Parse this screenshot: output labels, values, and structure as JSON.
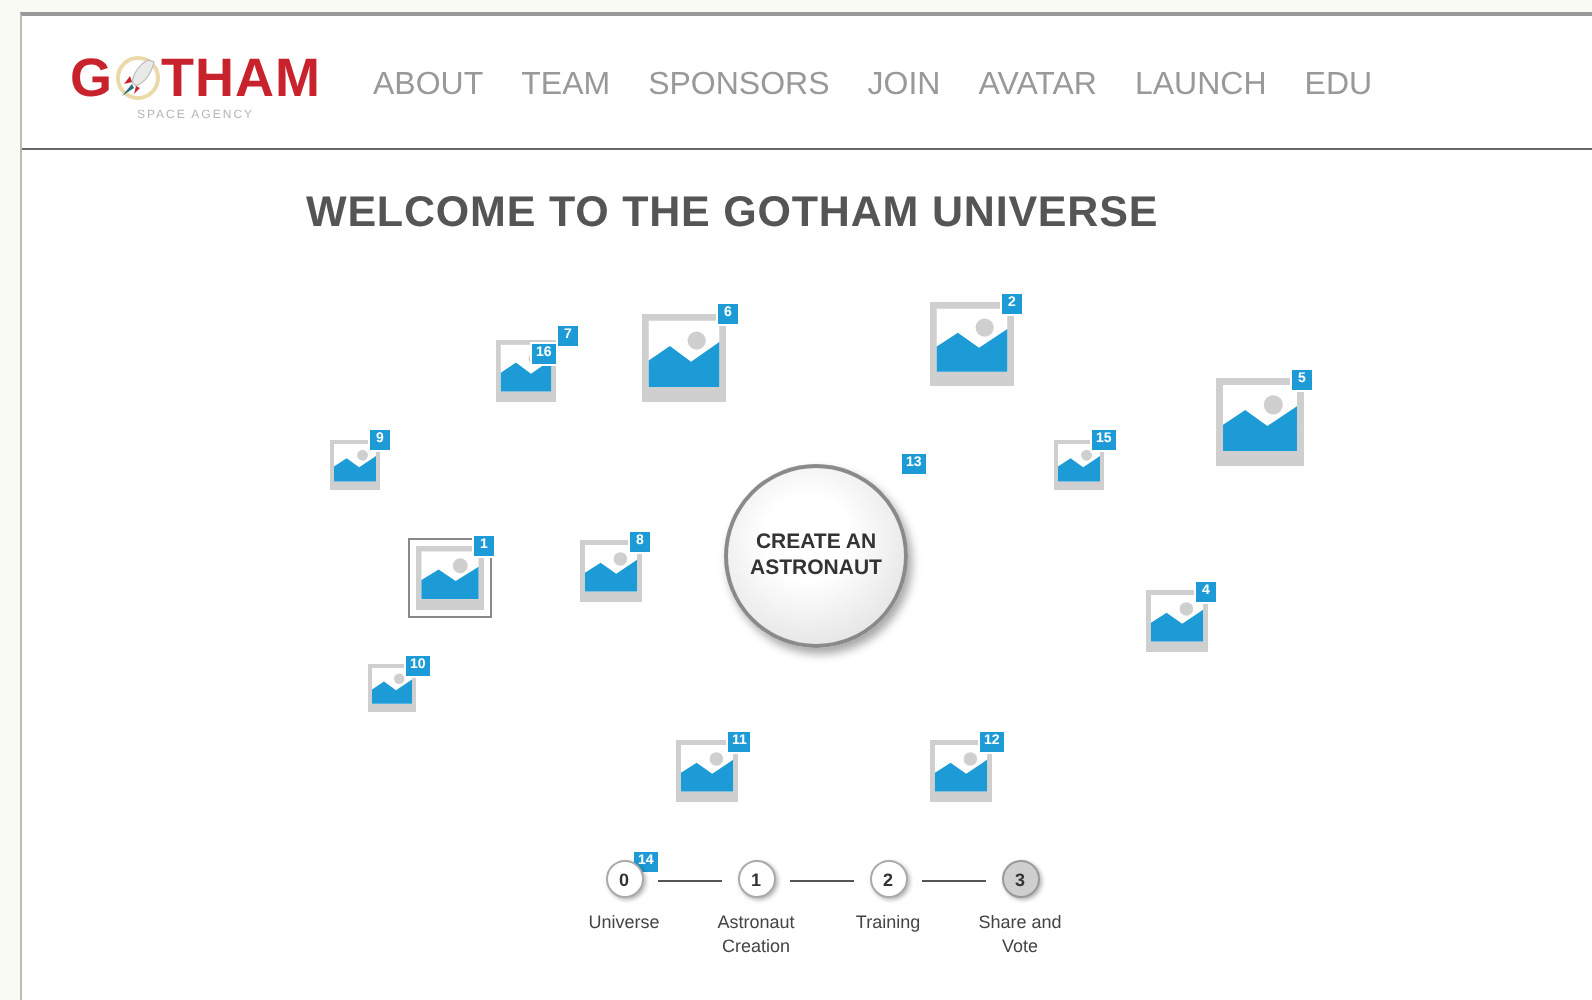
{
  "logo": {
    "before": "G",
    "after": "THAM",
    "tagline": "SPACE AGENCY"
  },
  "nav": [
    "ABOUT",
    "TEAM",
    "SPONSORS",
    "JOIN",
    "AVATAR",
    "LAUNCH",
    "EDU"
  ],
  "title": "WELCOME TO THE GOTHAM UNIVERSE",
  "items": [
    {
      "kind": "image",
      "badge": "6",
      "selected": false
    },
    {
      "kind": "image",
      "badge": "2",
      "selected": false
    },
    {
      "kind": "badge",
      "badge": "7"
    },
    {
      "kind": "image",
      "badge": "16",
      "selected": false
    },
    {
      "kind": "image",
      "badge": "5",
      "selected": false
    },
    {
      "kind": "image",
      "badge": "9",
      "selected": false
    },
    {
      "kind": "image",
      "badge": "15",
      "selected": false
    },
    {
      "kind": "badge",
      "badge": "13"
    },
    {
      "kind": "image",
      "badge": "1",
      "selected": true
    },
    {
      "kind": "image",
      "badge": "8",
      "selected": false
    },
    {
      "kind": "image",
      "badge": "4",
      "selected": false
    },
    {
      "kind": "image",
      "badge": "10",
      "selected": false
    },
    {
      "kind": "image",
      "badge": "11",
      "selected": false
    },
    {
      "kind": "image",
      "badge": "12",
      "selected": false
    },
    {
      "kind": "badge",
      "badge": "14"
    }
  ],
  "create_button": "CREATE AN ASTRONAUT",
  "steps": [
    {
      "number": "0",
      "label": "Universe",
      "selected": false
    },
    {
      "number": "1",
      "label": "Astronaut Creation",
      "selected": false
    },
    {
      "number": "2",
      "label": "Training",
      "selected": false
    },
    {
      "number": "3",
      "label": "Share and Vote",
      "selected": true
    }
  ]
}
